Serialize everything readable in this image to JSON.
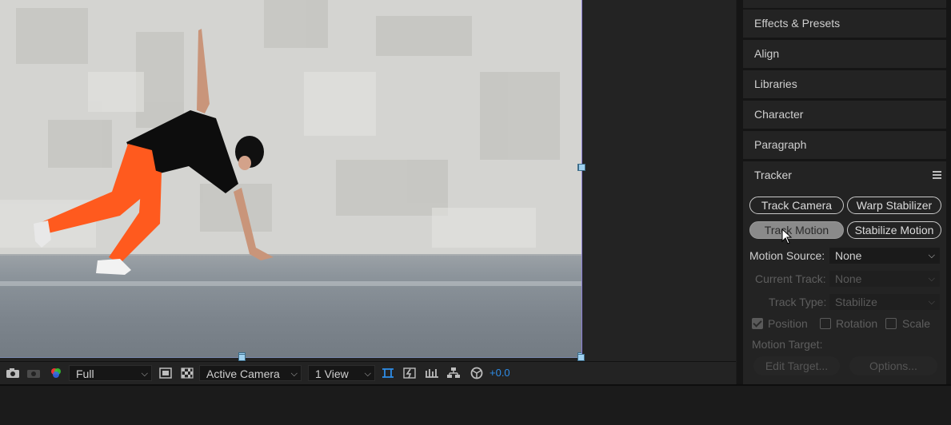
{
  "viewer": {
    "toolbar": {
      "resolution": "Full",
      "camera": "Active Camera",
      "views": "1 View",
      "exposure": "+0.0"
    }
  },
  "panels": [
    {
      "label": "Effects & Presets"
    },
    {
      "label": "Align"
    },
    {
      "label": "Libraries"
    },
    {
      "label": "Character"
    },
    {
      "label": "Paragraph"
    }
  ],
  "tracker": {
    "title": "Tracker",
    "buttons": {
      "track_camera": "Track Camera",
      "warp_stabilizer": "Warp Stabilizer",
      "track_motion": "Track Motion",
      "stabilize_motion": "Stabilize Motion"
    },
    "motion_source": {
      "label": "Motion Source:",
      "value": "None"
    },
    "current_track": {
      "label": "Current Track:",
      "value": "None"
    },
    "track_type": {
      "label": "Track Type:",
      "value": "Stabilize"
    },
    "options": {
      "position": {
        "label": "Position",
        "checked": true
      },
      "rotation": {
        "label": "Rotation",
        "checked": false
      },
      "scale": {
        "label": "Scale",
        "checked": false
      }
    },
    "motion_target": {
      "label": "Motion Target:"
    },
    "edit_target": "Edit Target...",
    "options_button": "Options..."
  },
  "colors": {
    "accent_blue": "#2e8de8",
    "panel_bg": "#232323",
    "active_pill": "#8a8a8a",
    "pants": "#ff5a1e"
  }
}
